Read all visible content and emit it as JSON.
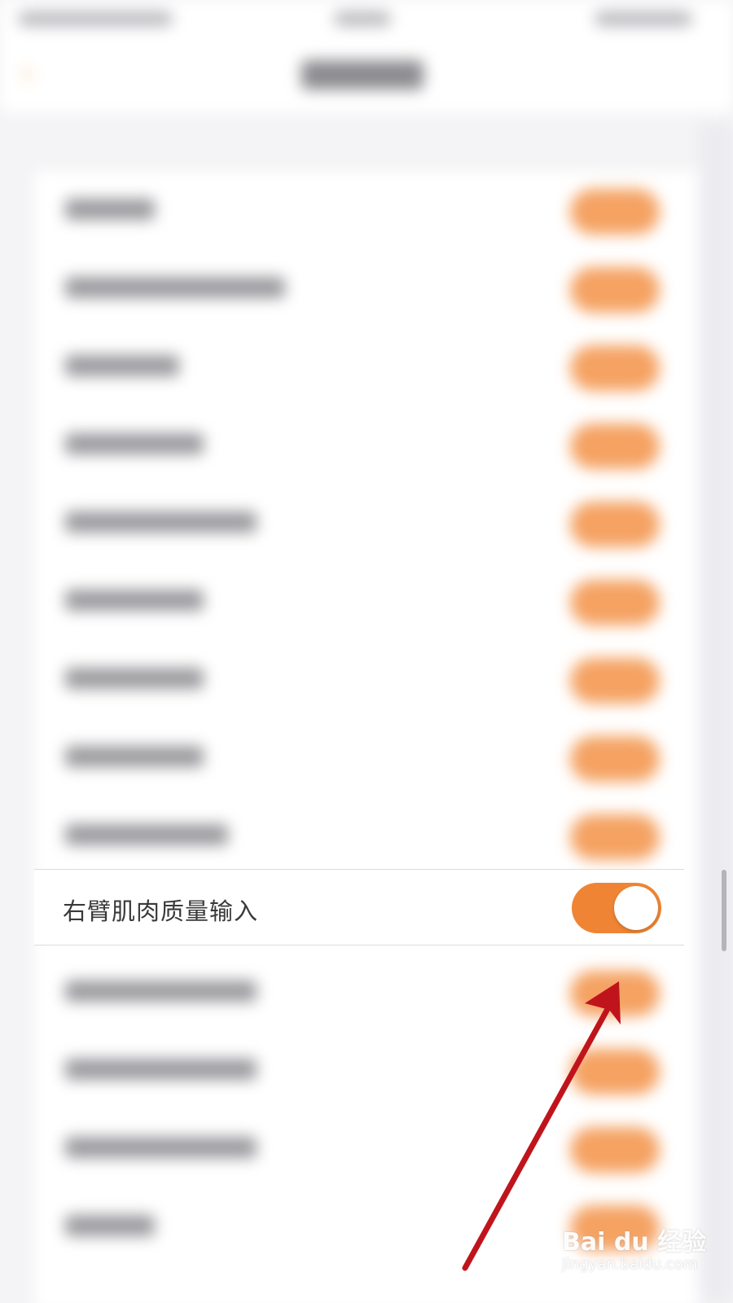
{
  "focused_setting": {
    "label": "右臂肌肉质量输入",
    "toggle_on": true,
    "toggle_color": "#ef8534"
  },
  "icons": {
    "back": "back-arrow-icon",
    "annotation": "red-pointer-arrow"
  },
  "colors": {
    "accent": "#ef8534",
    "annotation_arrow": "#c0141c",
    "background": "#f4f4f6"
  },
  "watermark": {
    "brand": "Bai du 经验",
    "url": "jingyan.baidu.com"
  }
}
